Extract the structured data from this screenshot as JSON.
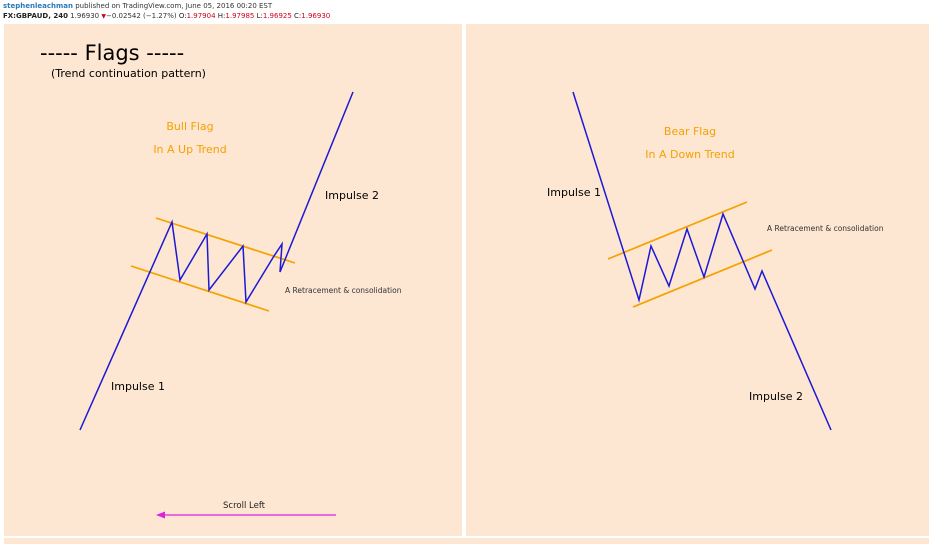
{
  "header": {
    "author": "stephenleachman",
    "published": "published on TradingView.com, June 05, 2016 00:20 EST",
    "symbol": "FX:GBPAUD, 240",
    "price": "1.96930",
    "change": "−0.02542 (−1.27%)",
    "open_label": "O:",
    "open": "1.97904",
    "high_label": "H:",
    "high": "1.97985",
    "low_label": "L:",
    "low": "1.96925",
    "close_label": "C:",
    "close": "1.96930"
  },
  "diagram": {
    "title": "----- Flags -----",
    "subtitle": "(Trend continuation pattern)",
    "bull": {
      "heading1": "Bull Flag",
      "heading2": "In A Up Trend",
      "impulse1": "Impulse 1",
      "impulse2": "Impulse 2",
      "retracement": "A Retracement & consolidation"
    },
    "bear": {
      "heading1": "Bear Flag",
      "heading2": "In A Down Trend",
      "impulse1": "Impulse 1",
      "impulse2": "Impulse 2",
      "retracement": "A Retracement & consolidation"
    },
    "scroll_label": "Scroll Left"
  },
  "colors": {
    "panel_bg": "#fde6d2",
    "price_line": "#1a1ad6",
    "flag_channel": "#f5a100",
    "orange_text": "#f5a100",
    "scroll_arrow": "#e020e0",
    "negative": "#d0021b",
    "author": "#2a7ab8"
  }
}
